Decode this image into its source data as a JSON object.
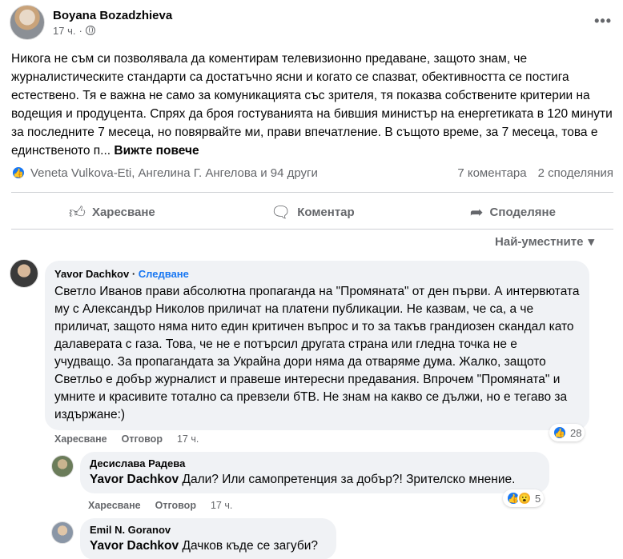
{
  "post": {
    "author": "Boyana Bozadzhieva",
    "time": "17 ч.",
    "body": "Никога не съм си позволявала да коментирам телевизионно предаване, защото знам, че журналистическите стандарти са достатъчно ясни и когато се спазват, обективността се постига естествено. Тя е важна не само за комуникацията със зрителя, тя показва собствените критерии на водещия и продуцента. Спрях да броя гостуванията на бившия министър на енергетиката в 120 минути за последните 7 месеца, но повярвайте ми, прави впечатление. В същото време, за 7 месеца, това е единственото п...",
    "see_more": "Вижте повече",
    "reactions_text": "Veneta Vulkova-Eti, Ангелина Г. Ангелова и 94 други",
    "comments_count": "7 коментара",
    "shares_count": "2 споделяния"
  },
  "actions": {
    "like": "Харесване",
    "comment": "Коментар",
    "share": "Споделяне"
  },
  "sort_label": "Най-уместните",
  "comments": [
    {
      "author": "Yavor Dachkov",
      "follow": "Следване",
      "text": "Светло Иванов прави абсолютна пропаганда на \"Промяната\" от ден първи. А интервютата му с Александър Николов приличат на платени публикации. Не казвам, че са, а че приличат, защото няма нито един критичен въпрос и то за такъв грандиозен скандал като далаверата с газа. Това, че не е потърсил другата страна или гледна точка не е учудващо. За пропагандата за Украйна дори няма да отваряме дума. Жалко, защото Светльо е добър журналист и правеше интересни предавания. Впрочем \"Промяната\" и умните и красивите тотално са превзели бТВ. Не знам на какво се дължи, но е тегаво за издържане:)",
      "like_label": "Харесване",
      "reply_label": "Отговор",
      "time": "17 ч.",
      "reaction_count": "28"
    },
    {
      "author": "Десислава Радева",
      "mention": "Yavor Dachkov",
      "text": "Дали? Или самопретенция за добър?! Зрителско мнение.",
      "like_label": "Харесване",
      "reply_label": "Отговор",
      "time": "17 ч.",
      "reaction_count": "5"
    },
    {
      "author": "Emil N. Goranov",
      "mention": "Yavor Dachkov",
      "text": "Дачков къде се загуби?"
    }
  ]
}
